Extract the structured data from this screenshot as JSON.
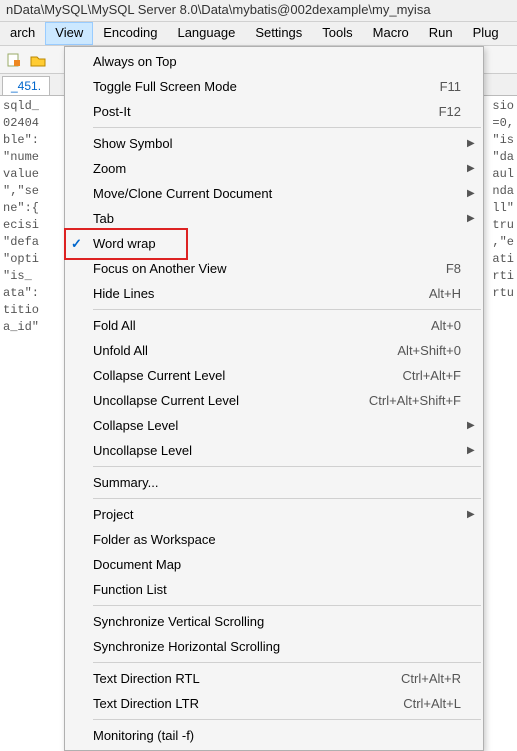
{
  "titlebar": "nData\\MySQL\\MySQL Server 8.0\\Data\\mybatis@002dexample\\my_myisa",
  "menubar": {
    "items": [
      "arch",
      "View",
      "Encoding",
      "Language",
      "Settings",
      "Tools",
      "Macro",
      "Run",
      "Plug"
    ],
    "active_index": 1
  },
  "tab": {
    "label": "_451."
  },
  "code_lines": [
    "sqld_",
    "02404",
    "ble\":",
    "\"nume",
    "value",
    "\",\"se",
    "ne\":{",
    "ecisi",
    "\"defa",
    "\"opti",
    "\"is_",
    "ata\":",
    "titio",
    "a_id\""
  ],
  "code_right": [
    "sio",
    "=0,",
    "\"is",
    "\"da",
    "aul",
    "nda",
    "ll\"",
    "tru",
    ",\"e",
    "ati",
    "rti",
    "rtu",
    "",
    ""
  ],
  "dropdown": {
    "groups": [
      [
        {
          "label": "Always on Top",
          "shortcut": "",
          "submenu": false,
          "checked": false
        },
        {
          "label": "Toggle Full Screen Mode",
          "shortcut": "F11",
          "submenu": false,
          "checked": false
        },
        {
          "label": "Post-It",
          "shortcut": "F12",
          "submenu": false,
          "checked": false
        }
      ],
      [
        {
          "label": "Show Symbol",
          "shortcut": "",
          "submenu": true,
          "checked": false
        },
        {
          "label": "Zoom",
          "shortcut": "",
          "submenu": true,
          "checked": false
        },
        {
          "label": "Move/Clone Current Document",
          "shortcut": "",
          "submenu": true,
          "checked": false
        },
        {
          "label": "Tab",
          "shortcut": "",
          "submenu": true,
          "checked": false
        },
        {
          "label": "Word wrap",
          "shortcut": "",
          "submenu": false,
          "checked": true
        },
        {
          "label": "Focus on Another View",
          "shortcut": "F8",
          "submenu": false,
          "checked": false
        },
        {
          "label": "Hide Lines",
          "shortcut": "Alt+H",
          "submenu": false,
          "checked": false
        }
      ],
      [
        {
          "label": "Fold All",
          "shortcut": "Alt+0",
          "submenu": false,
          "checked": false
        },
        {
          "label": "Unfold All",
          "shortcut": "Alt+Shift+0",
          "submenu": false,
          "checked": false
        },
        {
          "label": "Collapse Current Level",
          "shortcut": "Ctrl+Alt+F",
          "submenu": false,
          "checked": false
        },
        {
          "label": "Uncollapse Current Level",
          "shortcut": "Ctrl+Alt+Shift+F",
          "submenu": false,
          "checked": false
        },
        {
          "label": "Collapse Level",
          "shortcut": "",
          "submenu": true,
          "checked": false
        },
        {
          "label": "Uncollapse Level",
          "shortcut": "",
          "submenu": true,
          "checked": false
        }
      ],
      [
        {
          "label": "Summary...",
          "shortcut": "",
          "submenu": false,
          "checked": false
        }
      ],
      [
        {
          "label": "Project",
          "shortcut": "",
          "submenu": true,
          "checked": false
        },
        {
          "label": "Folder as Workspace",
          "shortcut": "",
          "submenu": false,
          "checked": false
        },
        {
          "label": "Document Map",
          "shortcut": "",
          "submenu": false,
          "checked": false
        },
        {
          "label": "Function List",
          "shortcut": "",
          "submenu": false,
          "checked": false
        }
      ],
      [
        {
          "label": "Synchronize Vertical Scrolling",
          "shortcut": "",
          "submenu": false,
          "checked": false
        },
        {
          "label": "Synchronize Horizontal Scrolling",
          "shortcut": "",
          "submenu": false,
          "checked": false
        }
      ],
      [
        {
          "label": "Text Direction RTL",
          "shortcut": "Ctrl+Alt+R",
          "submenu": false,
          "checked": false
        },
        {
          "label": "Text Direction LTR",
          "shortcut": "Ctrl+Alt+L",
          "submenu": false,
          "checked": false
        }
      ],
      [
        {
          "label": "Monitoring (tail -f)",
          "shortcut": "",
          "submenu": false,
          "checked": false
        }
      ]
    ]
  },
  "highlight": "word-wrap-row"
}
